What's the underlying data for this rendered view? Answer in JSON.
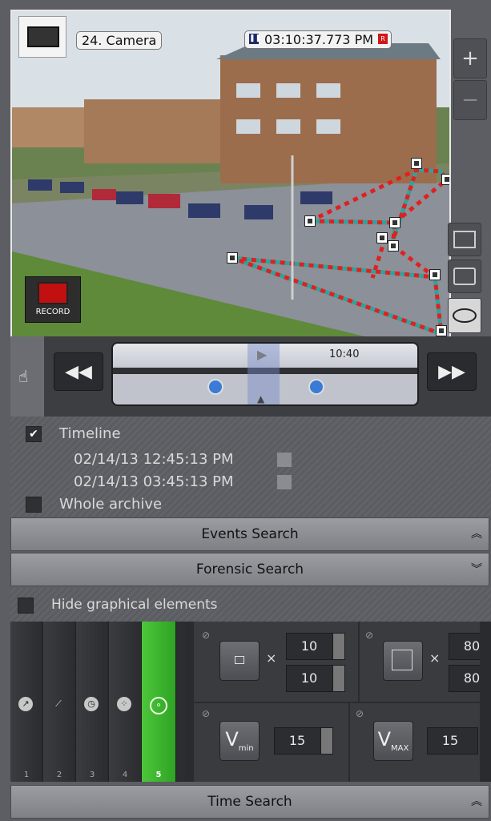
{
  "camera": {
    "name": "24. Camera",
    "timestamp": "03:10:37.773 PM",
    "record_label": "RECORD"
  },
  "zoom": {
    "plus": "+",
    "minus": "−"
  },
  "playback": {
    "time_label": "10:40"
  },
  "range": {
    "timeline_label": "Timeline",
    "timeline_checked": true,
    "start": "02/14/13 12:45:13 PM",
    "end": "02/14/13 03:45:13 PM",
    "whole_archive_label": "Whole archive",
    "whole_archive_checked": false
  },
  "sections": {
    "events": "Events Search",
    "forensic": "Forensic Search",
    "time": "Time Search"
  },
  "hide_graphics_label": "Hide graphical elements",
  "tools": [
    {
      "num": "1",
      "icon": "arrow-circle-icon"
    },
    {
      "num": "2",
      "icon": "line-cross-icon"
    },
    {
      "num": "3",
      "icon": "clock-icon"
    },
    {
      "num": "4",
      "icon": "dots-icon"
    },
    {
      "num": "5",
      "icon": "zones-icon",
      "active": true
    }
  ],
  "params": {
    "min_size_w": "10",
    "min_size_h": "10",
    "max_size_w": "80",
    "max_size_h": "80",
    "v_min": "15",
    "v_max": "15",
    "v_min_label": "min",
    "v_max_label": "MAX",
    "times": "×"
  },
  "colors": {
    "accent": "#3cbf2d",
    "zone_line_red": "#e02020",
    "zone_line_teal": "#2fa39b"
  }
}
